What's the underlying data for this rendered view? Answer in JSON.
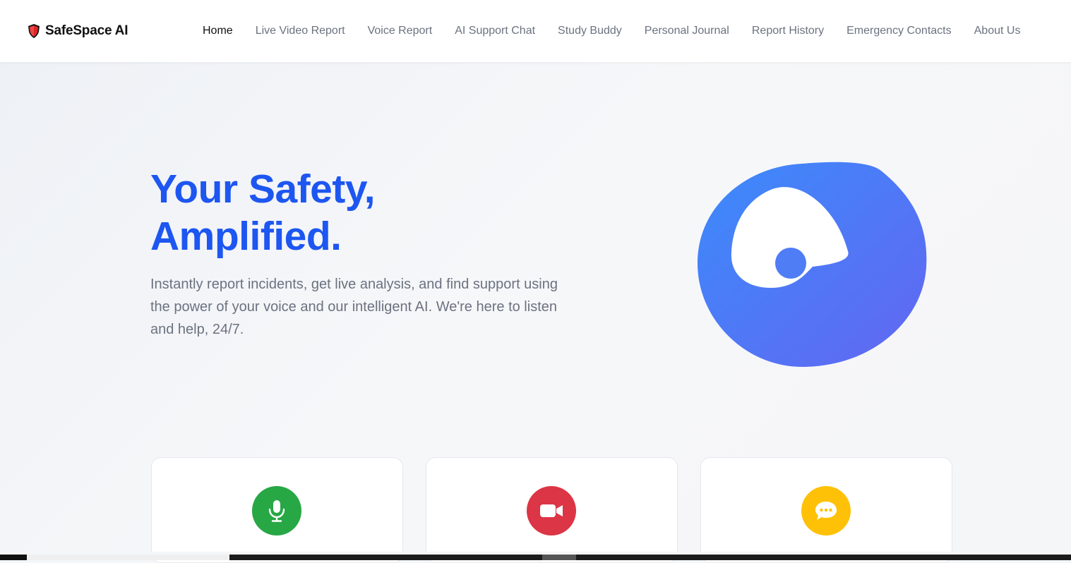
{
  "brand": {
    "name": "SafeSpace AI",
    "icon": "shield-icon",
    "icon_color": "#dc2626"
  },
  "nav": {
    "items": [
      {
        "label": "Home",
        "active": true
      },
      {
        "label": "Live Video Report",
        "active": false
      },
      {
        "label": "Voice Report",
        "active": false
      },
      {
        "label": "AI Support Chat",
        "active": false
      },
      {
        "label": "Study Buddy",
        "active": false
      },
      {
        "label": "Personal Journal",
        "active": false
      },
      {
        "label": "Report History",
        "active": false
      },
      {
        "label": "Emergency Contacts",
        "active": false
      },
      {
        "label": "About Us",
        "active": false
      }
    ]
  },
  "hero": {
    "title_line1": "Your Safety,",
    "title_line2": "Amplified.",
    "subtitle": "Instantly report incidents, get live analysis, and find support using the power of your voice and our intelligent AI. We're here to listen and help, 24/7.",
    "title_color": "#1d56f0",
    "graphic": {
      "name": "eye-logo",
      "gradient": [
        "#3b8bfb",
        "#6366f1"
      ]
    }
  },
  "cards": [
    {
      "icon": "microphone-icon",
      "color": "#28a745"
    },
    {
      "icon": "video-camera-icon",
      "color": "#dc3545"
    },
    {
      "icon": "chat-bubble-icon",
      "color": "#ffc107"
    }
  ]
}
